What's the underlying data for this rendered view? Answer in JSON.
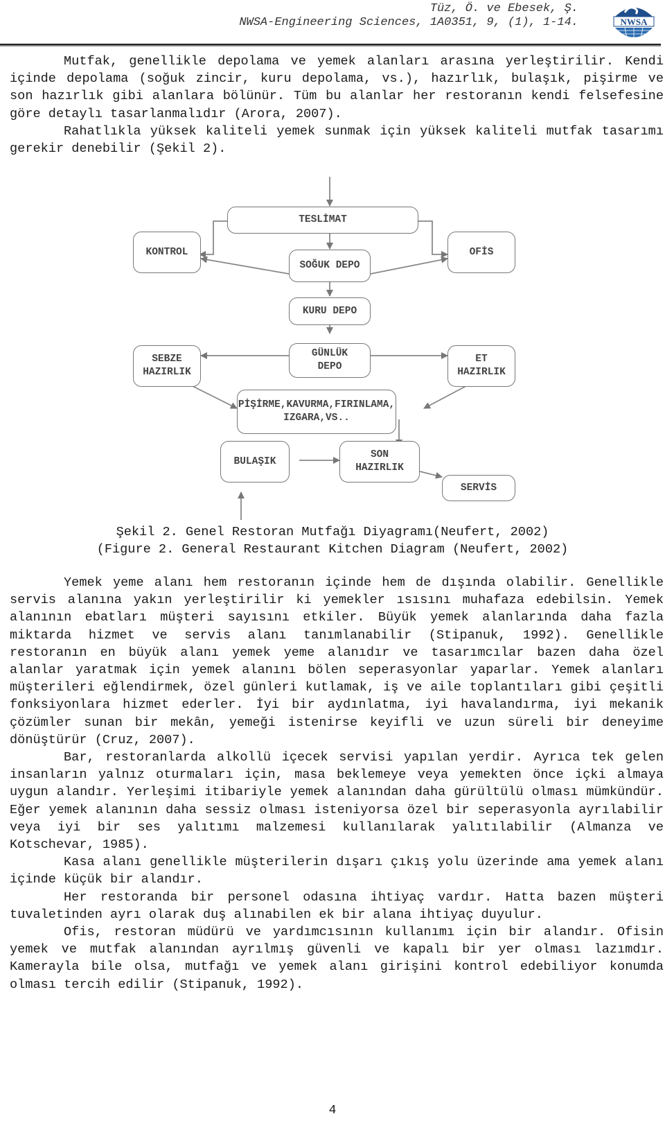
{
  "header": {
    "authors": "Tüz, Ö. ve Ebesek, Ş.",
    "journal": "NWSA-Engineering Sciences, 1A0351, 9, (1), 1-14.",
    "logo_text": "NWSA",
    "logo_color": "#1f4e8c"
  },
  "intro": {
    "paragraphs": [
      "Mutfak, genellikle depolama ve yemek alanları arasına yerleştirilir. Kendi içinde depolama (soğuk zincir, kuru depolama, vs.), hazırlık, bulaşık, pişirme ve son hazırlık gibi alanlara bölünür. Tüm bu alanlar her restoranın kendi felsefesine göre detaylı tasarlanmalıdır (Arora, 2007).",
      "Rahatlıkla yüksek kaliteli yemek sunmak için yüksek kaliteli mutfak tasarımı gerekir denebilir (Şekil 2)."
    ]
  },
  "diagram": {
    "nodes": {
      "teslimat": "TESLİMAT",
      "kontrol": "KONTROL",
      "ofis": "OFİS",
      "soguk_depo": "SOĞUK DEPO",
      "kuru_depo": "KURU DEPO",
      "gunluk_depo": "GÜNLÜK DEPO",
      "sebze_hazirlik": "SEBZE HAZIRLIK",
      "et_hazirlik": "ET HAZIRLIK",
      "pisirme": "PİŞİRME,KAVURMA,FIRINLAMA, IZGARA,VS..",
      "bulasik": "BULAŞIK",
      "son_hazirlik": "SON HAZIRLIK",
      "servis": "SERVİS"
    },
    "edges": [
      [
        "entry",
        "teslimat"
      ],
      [
        "teslimat",
        "kontrol"
      ],
      [
        "teslimat",
        "ofis"
      ],
      [
        "teslimat",
        "soguk_depo"
      ],
      [
        "soguk_depo",
        "kontrol"
      ],
      [
        "soguk_depo",
        "ofis"
      ],
      [
        "soguk_depo",
        "kuru_depo"
      ],
      [
        "kuru_depo",
        "gunluk_depo"
      ],
      [
        "gunluk_depo",
        "sebze_hazirlik"
      ],
      [
        "gunluk_depo",
        "et_hazirlik"
      ],
      [
        "sebze_hazirlik",
        "pisirme"
      ],
      [
        "et_hazirlik",
        "pisirme"
      ],
      [
        "pisirme",
        "son_hazirlik"
      ],
      [
        "bulasik",
        "son_hazirlik"
      ],
      [
        "son_hazirlik",
        "servis"
      ],
      [
        "entry",
        "bulasik"
      ]
    ]
  },
  "caption": {
    "tr": "Şekil 2. Genel Restoran Mutfağı Diyagramı(Neufert, 2002)",
    "en": "(Figure 2. General Restaurant Kitchen Diagram (Neufert, 2002)"
  },
  "body": {
    "paragraphs": [
      "Yemek yeme alanı hem restoranın içinde hem de dışında olabilir. Genellikle servis alanına yakın yerleştirilir ki yemekler ısısını muhafaza edebilsin. Yemek alanının ebatları müşteri sayısını etkiler. Büyük yemek alanlarında daha fazla miktarda hizmet ve servis alanı tanımlanabilir (Stipanuk, 1992). Genellikle restoranın en büyük alanı yemek yeme alanıdır ve tasarımcılar bazen daha özel alanlar yaratmak için yemek alanını bölen seperasyonlar yaparlar. Yemek alanları müşterileri eğlendirmek, özel günleri kutlamak, iş ve aile toplantıları gibi çeşitli fonksiyonlara hizmet ederler. İyi bir aydınlatma, iyi havalandırma, iyi mekanik çözümler sunan bir mekân, yemeği istenirse keyifli ve uzun süreli bir deneyime dönüştürür (Cruz, 2007).",
      "Bar, restoranlarda alkollü içecek servisi yapılan yerdir. Ayrıca tek gelen insanların yalnız oturmaları için, masa beklemeye veya yemekten önce içki almaya uygun alandır. Yerleşimi itibariyle yemek alanından daha gürültülü olması mümkündür. Eğer yemek alanının daha sessiz olması isteniyorsa özel bir seperasyonla ayrılabilir veya iyi bir ses yalıtımı malzemesi kullanılarak yalıtılabilir (Almanza ve Kotschevar, 1985).",
      "Kasa alanı genellikle müşterilerin dışarı çıkış yolu üzerinde ama yemek alanı içinde küçük bir alandır.",
      "Her restoranda bir personel odasına ihtiyaç vardır. Hatta bazen müşteri tuvaletinden ayrı olarak duş alınabilen ek bir alana ihtiyaç duyulur.",
      "Ofis, restoran müdürü ve yardımcısının kullanımı için bir alandır. Ofisin yemek ve mutfak alanından ayrılmış güvenli ve kapalı bir yer olması lazımdır. Kamerayla bile olsa, mutfağı ve yemek alanı girişini kontrol edebiliyor konumda olması tercih edilir (Stipanuk, 1992)."
    ]
  },
  "footer": {
    "page_number": "4"
  }
}
